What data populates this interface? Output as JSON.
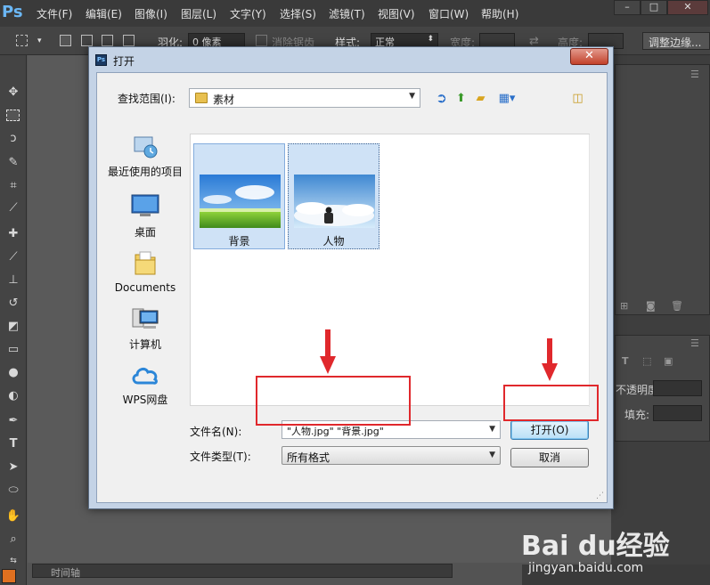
{
  "app": {
    "logo": "Ps",
    "menu": [
      "文件(F)",
      "编辑(E)",
      "图像(I)",
      "图层(L)",
      "文字(Y)",
      "选择(S)",
      "滤镜(T)",
      "视图(V)",
      "窗口(W)",
      "帮助(H)"
    ],
    "window_controls": [
      "–",
      "□",
      "✕"
    ]
  },
  "options_bar": {
    "feather_label": "羽化:",
    "feather_value": "0 像素",
    "antialias_label": "消除锯齿",
    "style_label": "样式:",
    "style_value": "正常",
    "width_label": "宽度:",
    "height_label": "高度:",
    "refine_button": "调整边缘..."
  },
  "timeline": {
    "label": "时间轴"
  },
  "right_panels": {
    "opacity_label": "不透明度:",
    "fill_label": "填充:"
  },
  "dialog": {
    "title": "打开",
    "close_glyph": "✕",
    "look_in_label": "查找范围(I):",
    "look_in_value": "素材",
    "places": [
      {
        "label": "最近使用的项目",
        "icon": "recent-items-icon"
      },
      {
        "label": "桌面",
        "icon": "desktop-icon"
      },
      {
        "label": "Documents",
        "icon": "documents-folder-icon"
      },
      {
        "label": "计算机",
        "icon": "computer-icon"
      },
      {
        "label": "WPS网盘",
        "icon": "wps-cloud-icon"
      }
    ],
    "files": [
      {
        "name": "背景",
        "icon": "landscape-thumbnail"
      },
      {
        "name": "人物",
        "icon": "person-sky-thumbnail"
      }
    ],
    "filename_label": "文件名(N):",
    "filename_value": "\"人物.jpg\" \"背景.jpg\"",
    "filetype_label": "文件类型(T):",
    "filetype_value": "所有格式",
    "open_button": "打开(O)",
    "cancel_button": "取消"
  },
  "annotations": {
    "color": "#e0282c"
  },
  "watermark": {
    "brand": "Bai du经验",
    "url": "jingyan.baidu.com"
  }
}
